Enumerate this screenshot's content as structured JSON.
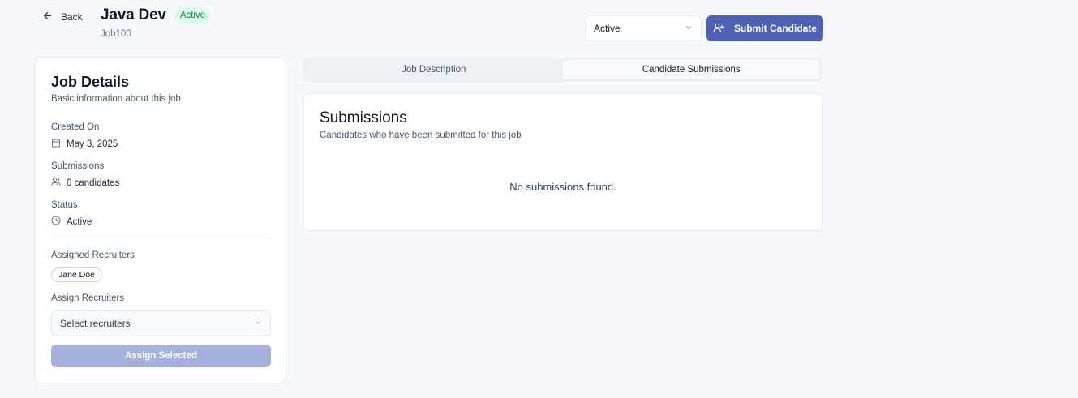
{
  "header": {
    "back_label": "Back",
    "job_title": "Java Dev",
    "status_badge": "Active",
    "job_id": "Job100",
    "status_select_value": "Active",
    "submit_button_label": "Submit Candidate"
  },
  "job_details": {
    "title": "Job Details",
    "subtitle": "Basic information about this job",
    "created_on_label": "Created On",
    "created_on_value": "May 3, 2025",
    "submissions_label": "Submissions",
    "submissions_value": "0 candidates",
    "status_label": "Status",
    "status_value": "Active",
    "assigned_recruiters_label": "Assigned Recruiters",
    "assigned_recruiters": [
      "Jane Doe"
    ],
    "assign_recruiters_label": "Assign Recruiters",
    "recruiter_select_placeholder": "Select recruiters",
    "assign_button_label": "Assign Selected"
  },
  "tabs": [
    {
      "label": "Job Description",
      "active": false
    },
    {
      "label": "Candidate Submissions",
      "active": true
    }
  ],
  "submissions": {
    "title": "Submissions",
    "subtitle": "Candidates who have been submitted for this job",
    "empty_message": "No submissions found."
  },
  "icons": {
    "back": "arrow-left-icon",
    "submit": "user-plus-icon",
    "created_on": "calendar-icon",
    "submissions": "users-icon",
    "status": "clock-icon",
    "dropdown": "chevron-down-icon"
  },
  "colors": {
    "primary": "#4f5fb3",
    "primary_disabled": "#a5b1dc",
    "badge_bg": "#dcfce7",
    "badge_text": "#15803d",
    "background": "#f6f8fb"
  }
}
